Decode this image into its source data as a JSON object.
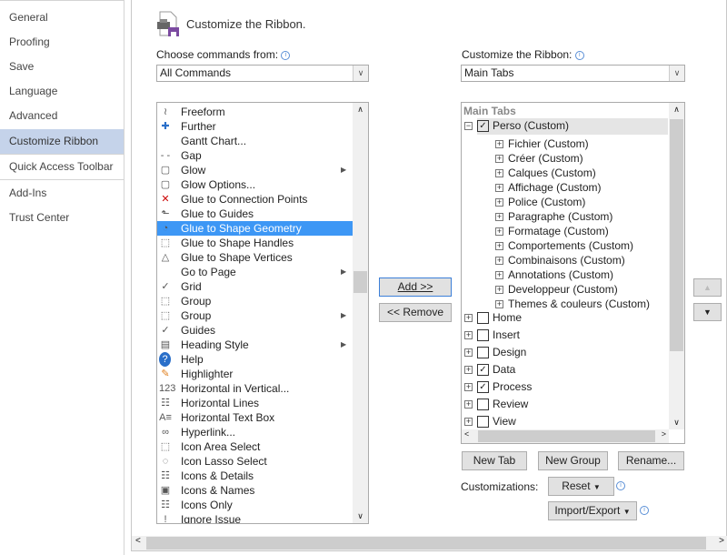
{
  "sidebar": {
    "items": [
      "General",
      "Proofing",
      "Save",
      "Language",
      "Advanced",
      "Customize Ribbon",
      "Quick Access Toolbar",
      "Add-Ins",
      "Trust Center"
    ],
    "active": "Customize Ribbon"
  },
  "header": {
    "title": "Customize the Ribbon."
  },
  "left": {
    "label": "Choose commands from:",
    "selected": "All Commands",
    "commands": [
      {
        "label": "Freeform",
        "icon": "freeform-icon",
        "glyph": "≀"
      },
      {
        "label": "Further",
        "icon": "plus-icon",
        "glyph": "✚"
      },
      {
        "label": "Gantt Chart...",
        "icon": "",
        "glyph": ""
      },
      {
        "label": "Gap",
        "icon": "gap-icon",
        "glyph": "- -"
      },
      {
        "label": "Glow",
        "icon": "glow-icon",
        "glyph": "▢",
        "sub": true
      },
      {
        "label": "Glow Options...",
        "icon": "glow-options-icon",
        "glyph": "▢"
      },
      {
        "label": "Glue to Connection Points",
        "icon": "glue-connection-icon",
        "glyph": "✕"
      },
      {
        "label": "Glue to Guides",
        "icon": "glue-guides-icon",
        "glyph": "⬑"
      },
      {
        "label": "Glue to Shape Geometry",
        "icon": "glue-geometry-icon",
        "glyph": "◔",
        "selected": true
      },
      {
        "label": "Glue to Shape Handles",
        "icon": "glue-handles-icon",
        "glyph": "⬚"
      },
      {
        "label": "Glue to Shape Vertices",
        "icon": "glue-vertices-icon",
        "glyph": "△"
      },
      {
        "label": "Go to Page",
        "icon": "",
        "glyph": "",
        "sub": true
      },
      {
        "label": "Grid",
        "icon": "check-icon",
        "glyph": "✓"
      },
      {
        "label": "Group",
        "icon": "group-icon",
        "glyph": "⬚"
      },
      {
        "label": "Group",
        "icon": "group-icon",
        "glyph": "⬚",
        "sub": true
      },
      {
        "label": "Guides",
        "icon": "check-icon",
        "glyph": "✓"
      },
      {
        "label": "Heading Style",
        "icon": "heading-style-icon",
        "glyph": "▤",
        "sub": true
      },
      {
        "label": "Help",
        "icon": "help-icon",
        "glyph": "?"
      },
      {
        "label": "Highlighter",
        "icon": "highlighter-icon",
        "glyph": "✎"
      },
      {
        "label": "Horizontal in Vertical...",
        "icon": "horizontal-in-vertical-icon",
        "glyph": "123"
      },
      {
        "label": "Horizontal Lines",
        "icon": "horizontal-lines-icon",
        "glyph": "☷"
      },
      {
        "label": "Horizontal Text Box",
        "icon": "text-box-icon",
        "glyph": "A≡"
      },
      {
        "label": "Hyperlink...",
        "icon": "hyperlink-icon",
        "glyph": "∞"
      },
      {
        "label": "Icon Area Select",
        "icon": "area-select-icon",
        "glyph": "⬚"
      },
      {
        "label": "Icon Lasso Select",
        "icon": "lasso-select-icon",
        "glyph": "◌"
      },
      {
        "label": "Icons & Details",
        "icon": "icons-details-icon",
        "glyph": "☷"
      },
      {
        "label": "Icons & Names",
        "icon": "icons-names-icon",
        "glyph": "▣"
      },
      {
        "label": "Icons Only",
        "icon": "icons-only-icon",
        "glyph": "☷"
      },
      {
        "label": "Ignore Issue",
        "icon": "ignore-issue-icon",
        "glyph": "!"
      }
    ]
  },
  "middle": {
    "add": "Add >>",
    "remove": "<< Remove"
  },
  "right": {
    "label": "Customize the Ribbon:",
    "selected": "Main Tabs",
    "tree_header": "Main Tabs",
    "root": {
      "label": "Perso (Custom)",
      "checked": true
    },
    "children": [
      "Fichier (Custom)",
      "Créer (Custom)",
      "Calques (Custom)",
      "Affichage (Custom)",
      "Police (Custom)",
      "Paragraphe (Custom)",
      "Formatage (Custom)",
      "Comportements (Custom)",
      "Combinaisons (Custom)",
      "Annotations (Custom)",
      "Developpeur (Custom)",
      "Themes & couleurs (Custom)"
    ],
    "tabs": [
      {
        "label": "Home",
        "checked": false
      },
      {
        "label": "Insert",
        "checked": false
      },
      {
        "label": "Design",
        "checked": false
      },
      {
        "label": "Data",
        "checked": true
      },
      {
        "label": "Process",
        "checked": true
      },
      {
        "label": "Review",
        "checked": false
      },
      {
        "label": "View",
        "checked": false
      }
    ]
  },
  "buttons": {
    "new_tab": "New Tab",
    "new_group": "New Group",
    "rename": "Rename...",
    "customizations": "Customizations:",
    "reset": "Reset",
    "import_export": "Import/Export"
  },
  "colors": {
    "selection": "#3d97f5",
    "active_nav": "#c5d3ea"
  }
}
